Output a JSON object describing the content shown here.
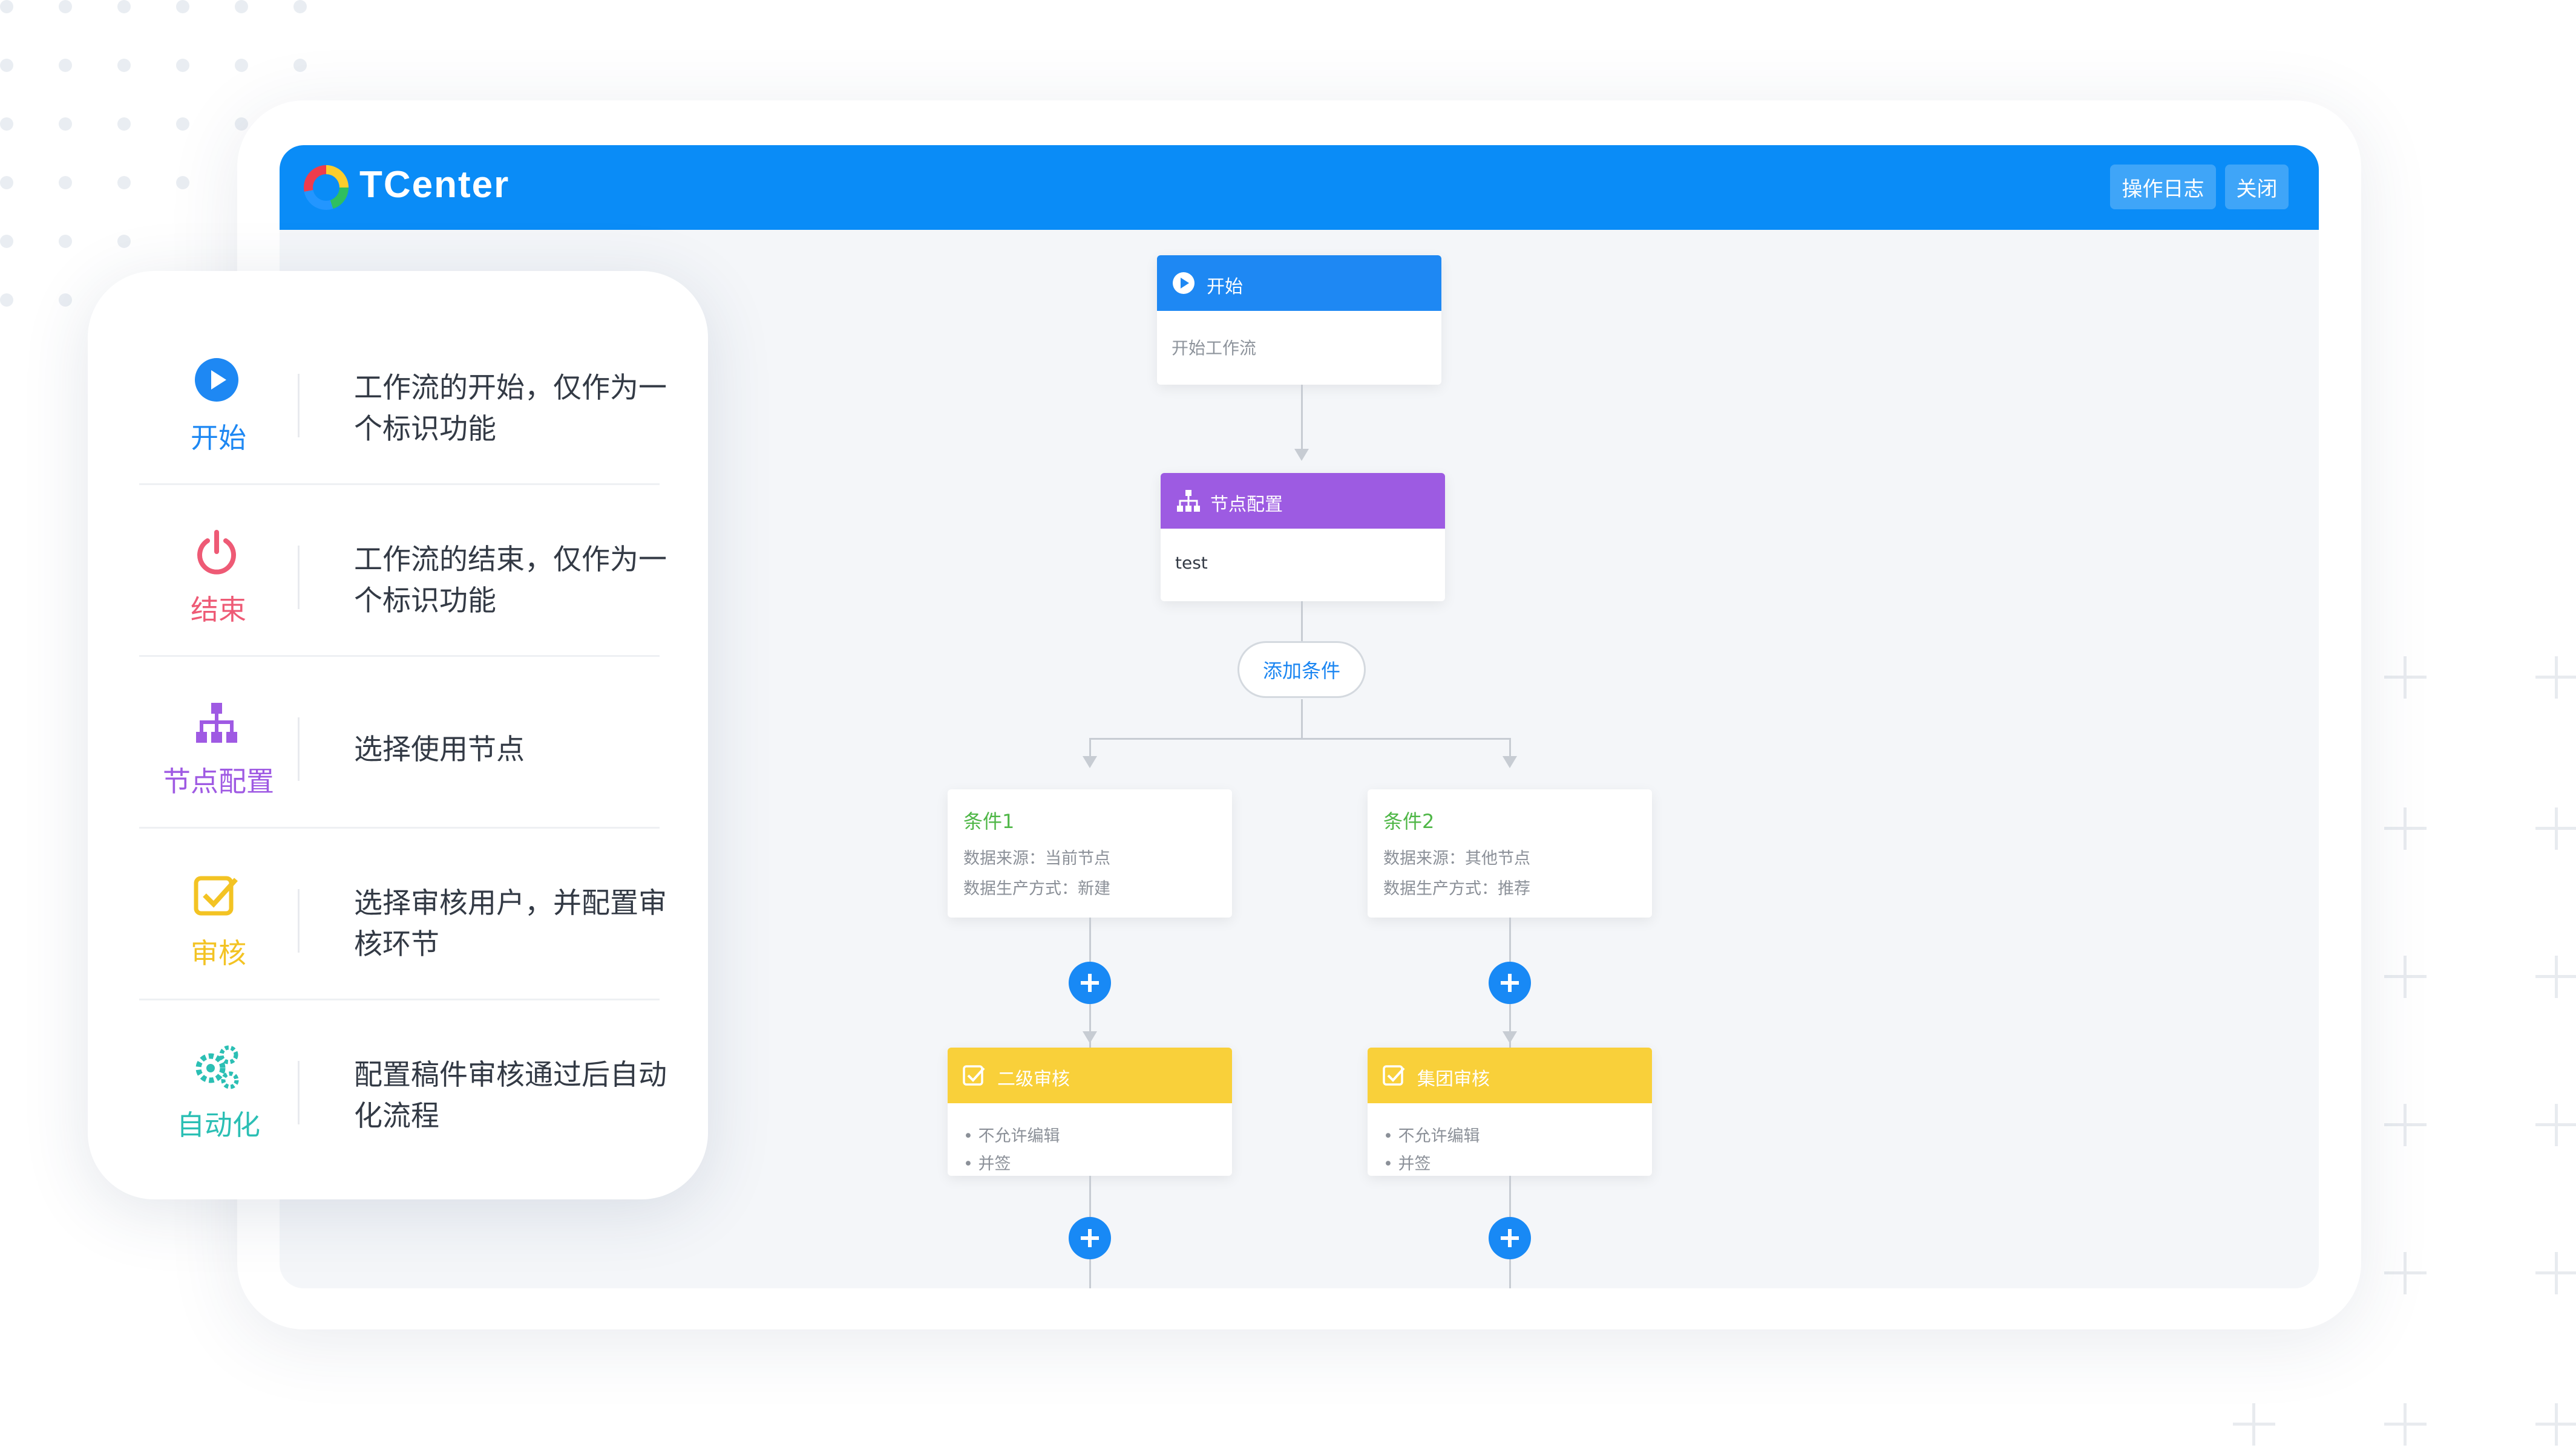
{
  "app": {
    "brand": "TCenter"
  },
  "header": {
    "log_button": "操作日志",
    "close_button": "关闭"
  },
  "legend": {
    "items": [
      {
        "label": "开始",
        "desc_line1": "工作流的开始，仅作为一",
        "desc_line2": "个标识功能",
        "color": "#1e88f3",
        "icon": "play-circle-icon"
      },
      {
        "label": "结束",
        "desc_line1": "工作流的结束，仅作为一",
        "desc_line2": "个标识功能",
        "color": "#ee5a75",
        "icon": "power-icon"
      },
      {
        "label": "节点配置",
        "desc_line1": "选择使用节点",
        "desc_line2": "",
        "color": "#9f5ae3",
        "icon": "sitemap-icon"
      },
      {
        "label": "审核",
        "desc_line1": "选择审核用户，并配置审",
        "desc_line2": "核环节",
        "color": "#f3c323",
        "icon": "check-square-icon"
      },
      {
        "label": "自动化",
        "desc_line1": "配置稿件审核通过后自动",
        "desc_line2": "化流程",
        "color": "#2bbfb4",
        "icon": "gears-icon"
      }
    ]
  },
  "flow": {
    "start": {
      "title": "开始",
      "body": "开始工作流",
      "color": "#1e88f3"
    },
    "config": {
      "title": "节点配置",
      "body": "test",
      "color": "#9d5be2"
    },
    "add_condition": "添加条件",
    "conditions": [
      {
        "title": "条件1",
        "source": "数据来源：当前节点",
        "mode": "数据生产方式：新建"
      },
      {
        "title": "条件2",
        "source": "数据来源：其他节点",
        "mode": "数据生产方式：推荐"
      }
    ],
    "reviews": [
      {
        "title": "二级审核",
        "bullet1": "不允许编辑",
        "bullet2": "并签"
      },
      {
        "title": "集团审核",
        "bullet1": "不允许编辑",
        "bullet2": "并签"
      }
    ],
    "review_color": "#f9d03a",
    "accent": "#1889f5"
  }
}
